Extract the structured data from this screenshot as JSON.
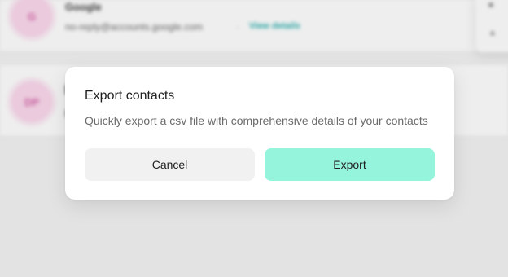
{
  "background": {
    "rows": [
      {
        "avatar_initials": "G",
        "sender_name": "Google",
        "sender_email": "no-reply@accounts.google.com",
        "separator": "·",
        "view_details_label": "View details"
      },
      {
        "avatar_initials": "DP"
      }
    ],
    "side_menu_icons": [
      "menu-item-icon",
      "menu-item-icon"
    ]
  },
  "dialog": {
    "title": "Export contacts",
    "description": "Quickly export a csv file with comprehensive details of your contacts",
    "cancel_label": "Cancel",
    "export_label": "Export"
  },
  "colors": {
    "export_button": "#95f5dc",
    "cancel_button": "#f1f1f1",
    "avatar": "#fbd4ea",
    "link": "#1aa8a8"
  }
}
